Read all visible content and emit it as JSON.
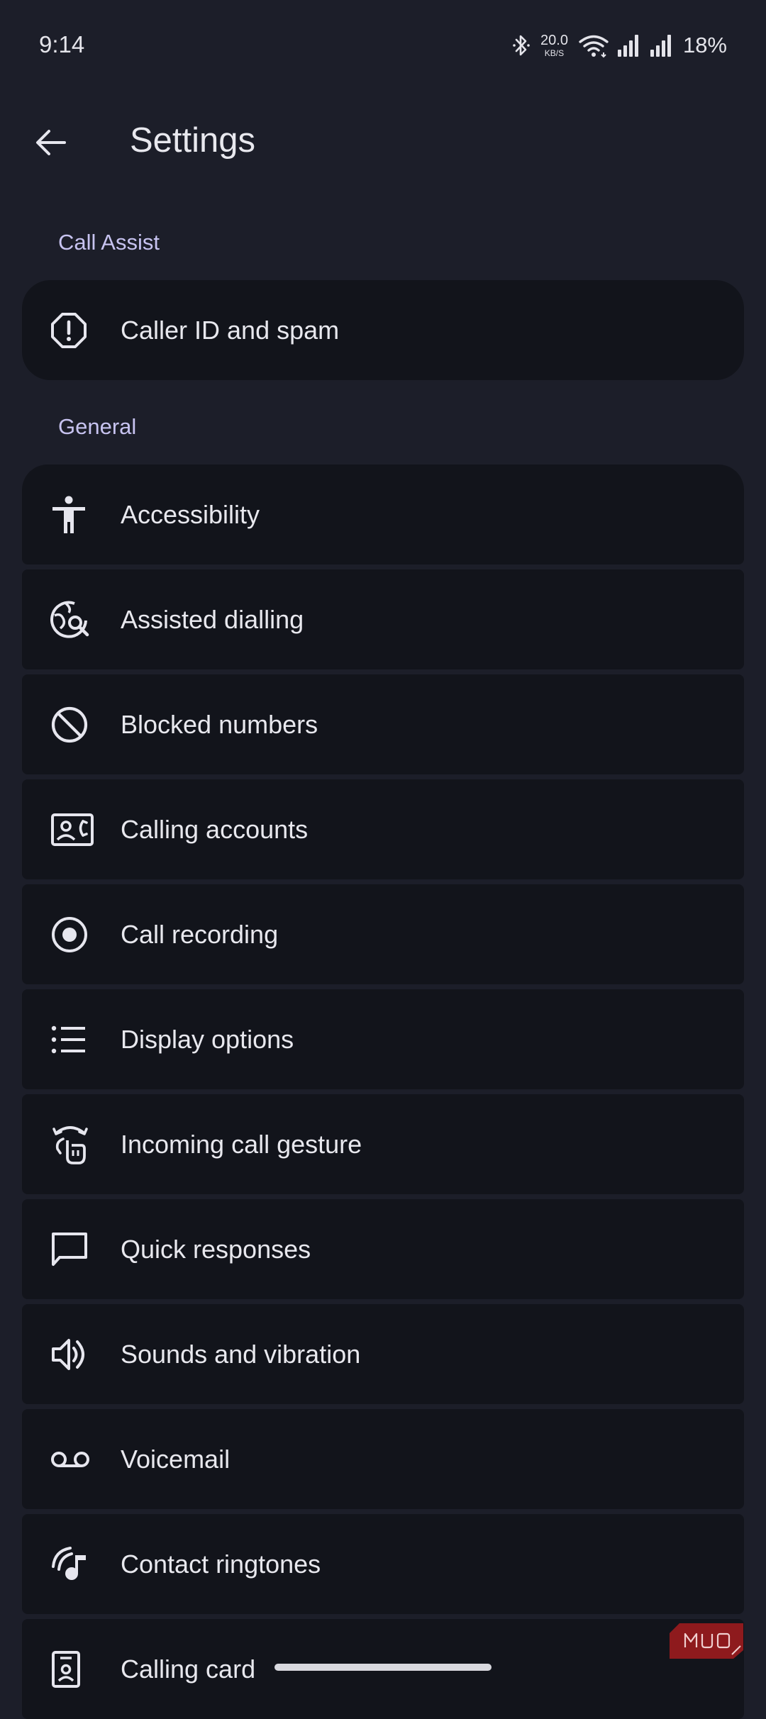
{
  "status_bar": {
    "time": "9:14",
    "network_speed_value": "20.0",
    "network_speed_unit": "KB/S",
    "battery": "18%",
    "icons": [
      "bluetooth-icon",
      "wifi-icon",
      "signal-icon",
      "signal-icon"
    ]
  },
  "header": {
    "title": "Settings",
    "back_icon": "arrow-left-icon"
  },
  "sections": {
    "call_assist": {
      "title": "Call Assist",
      "items": [
        {
          "label": "Caller ID and spam",
          "icon": "spam-octagon-icon"
        }
      ]
    },
    "general": {
      "title": "General",
      "items": [
        {
          "label": "Accessibility",
          "icon": "accessibility-icon"
        },
        {
          "label": "Assisted dialling",
          "icon": "globe-search-icon"
        },
        {
          "label": "Blocked numbers",
          "icon": "block-icon"
        },
        {
          "label": "Calling accounts",
          "icon": "contact-phone-icon"
        },
        {
          "label": "Call recording",
          "icon": "record-icon"
        },
        {
          "label": "Display options",
          "icon": "list-icon"
        },
        {
          "label": "Incoming call gesture",
          "icon": "gesture-icon"
        },
        {
          "label": "Quick responses",
          "icon": "chat-bubble-icon"
        },
        {
          "label": "Sounds and vibration",
          "icon": "volume-icon"
        },
        {
          "label": "Voicemail",
          "icon": "voicemail-icon"
        },
        {
          "label": "Contact ringtones",
          "icon": "ringtone-icon"
        },
        {
          "label": "Calling card",
          "icon": "calling-card-icon"
        }
      ]
    }
  },
  "watermark": {
    "text": "MUO"
  },
  "colors": {
    "background": "#1c1e29",
    "card": "#12141b",
    "section_header": "#c7c3f0",
    "text": "#e8e8ee",
    "watermark": "#8e1a1d"
  }
}
